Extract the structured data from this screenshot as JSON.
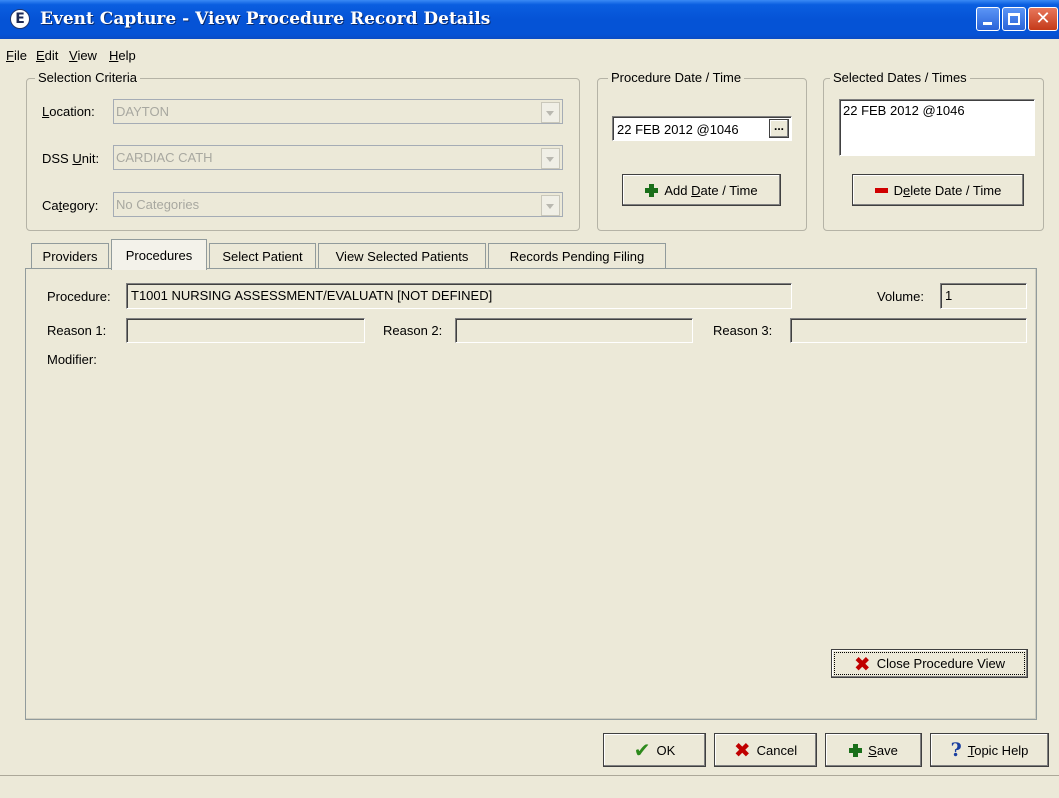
{
  "window": {
    "title": "Event Capture - View Procedure Record Details",
    "icon_glyph": "E",
    "close_glyph": "✕"
  },
  "menu": [
    {
      "label": "File",
      "mnemonic": "F",
      "rest": "ile"
    },
    {
      "label": "Edit",
      "mnemonic": "E",
      "rest": "dit"
    },
    {
      "label": "View",
      "mnemonic": "V",
      "rest": "iew"
    },
    {
      "label": "Help",
      "mnemonic": "H",
      "rest": "elp"
    }
  ],
  "selection_criteria": {
    "title": "Selection Criteria",
    "location": {
      "label_mn": "L",
      "label_rest": "ocation:",
      "value": "DAYTON"
    },
    "dss_unit": {
      "label_pre": "DSS ",
      "label_mn": "U",
      "label_rest": "nit:",
      "value": "CARDIAC CATH"
    },
    "category": {
      "label_pre": "Ca",
      "label_mn": "t",
      "label_rest": "egory:",
      "value": "No Categories"
    }
  },
  "procedure_datetime": {
    "title": "Procedure Date / Time",
    "value": "22 FEB 2012 @1046",
    "browse_label": "...",
    "add_label_pre": "Add ",
    "add_label_mn": "D",
    "add_label_rest": "ate / Time"
  },
  "selected_dates": {
    "title": "Selected Dates / Times",
    "items": [
      "22 FEB 2012 @1046"
    ],
    "delete_label_pre": "D",
    "delete_label_mn": "e",
    "delete_label_rest": "lete Date / Time"
  },
  "tabs": [
    {
      "label": "Providers",
      "active": false
    },
    {
      "label": "Procedures",
      "active": true
    },
    {
      "label": "Select Patient",
      "active": false
    },
    {
      "label": "View Selected Patients",
      "active": false
    },
    {
      "label": "Records Pending Filing",
      "active": false
    }
  ],
  "procedure_panel": {
    "procedure_label": "Procedure:",
    "procedure_value": "T1001 NURSING ASSESSMENT/EVALUATN [NOT DEFINED]",
    "volume_label": "Volume:",
    "volume_value": "1",
    "reason1_label": "Reason 1:",
    "reason1_value": "",
    "reason2_label": "Reason 2:",
    "reason2_value": "",
    "reason3_label": "Reason 3:",
    "reason3_value": "",
    "modifier_label": "Modifier:",
    "close_view_label": "Close Procedure View"
  },
  "footer_buttons": {
    "ok": "OK",
    "cancel": "Cancel",
    "save_mn": "S",
    "save_rest": "ave",
    "help_mn": "T",
    "help_rest": "opic Help"
  }
}
